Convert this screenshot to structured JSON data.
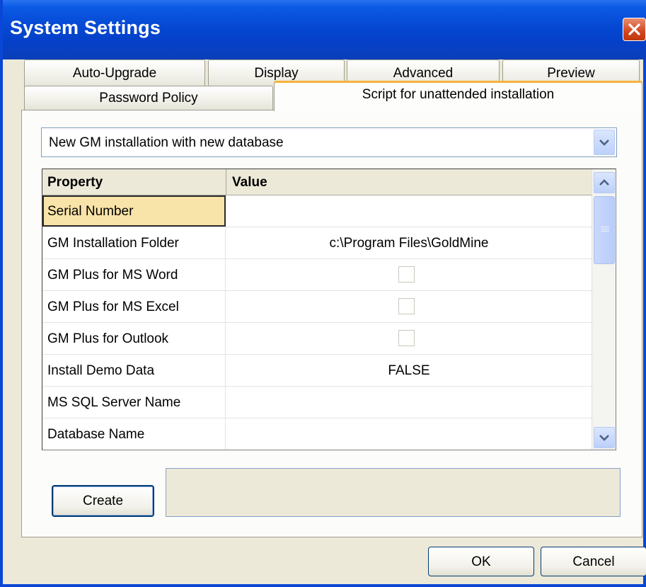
{
  "window": {
    "title": "System Settings"
  },
  "tabs_row1": [
    {
      "label": "Auto-Upgrade"
    },
    {
      "label": "Display"
    },
    {
      "label": "Advanced"
    },
    {
      "label": "Preview"
    }
  ],
  "tabs_row2": [
    {
      "label": "Password Policy",
      "active": false
    },
    {
      "label": "Script for unattended installation",
      "active": true
    }
  ],
  "script_type": {
    "selected": "New GM installation with new database"
  },
  "grid": {
    "headers": {
      "property": "Property",
      "value": "Value"
    },
    "rows": [
      {
        "property": "Serial Number",
        "value": "",
        "type": "text",
        "selected": true
      },
      {
        "property": "GM Installation Folder",
        "value": "c:\\Program Files\\GoldMine",
        "type": "text"
      },
      {
        "property": "GM Plus for MS Word",
        "value": "",
        "type": "checkbox",
        "checked": false
      },
      {
        "property": "GM Plus for MS Excel",
        "value": "",
        "type": "checkbox",
        "checked": false
      },
      {
        "property": "GM Plus for Outlook",
        "value": "",
        "type": "checkbox",
        "checked": false
      },
      {
        "property": "Install Demo Data",
        "value": "FALSE",
        "type": "text"
      },
      {
        "property": "MS SQL Server Name",
        "value": "",
        "type": "text"
      },
      {
        "property": "Database Name",
        "value": "",
        "type": "text"
      }
    ]
  },
  "buttons": {
    "create": "Create",
    "ok": "OK",
    "cancel": "Cancel"
  },
  "colors": {
    "titlebar": "#0548d2",
    "active_tab_accent": "#f8b23a",
    "selected_cell": "#f8e3a8"
  }
}
